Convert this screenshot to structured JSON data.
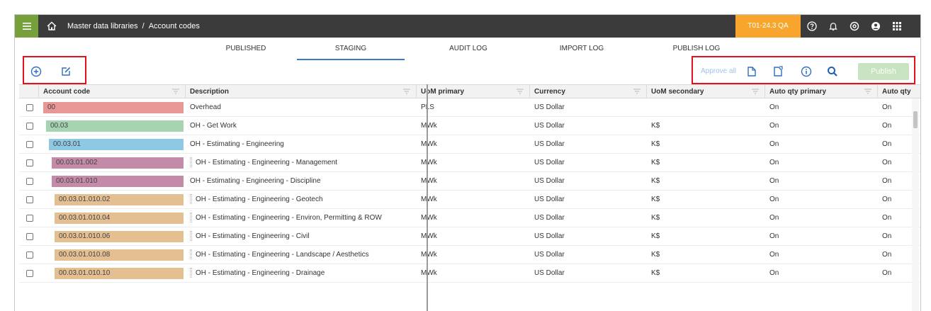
{
  "header": {
    "breadcrumb_root": "Master data libraries",
    "breadcrumb_separator": "/",
    "breadcrumb_current": "Account codes",
    "environment": "T01-24.3 QA",
    "icons": [
      "help-icon",
      "bell-icon",
      "settings-icon",
      "user-icon",
      "apps-grid-icon"
    ]
  },
  "tabs": [
    {
      "label": "PUBLISHED"
    },
    {
      "label": "STAGING",
      "active": true
    },
    {
      "label": "AUDIT LOG"
    },
    {
      "label": "IMPORT LOG"
    },
    {
      "label": "PUBLISH LOG"
    }
  ],
  "toolbar": {
    "approve_all": "Approve all",
    "publish": "Publish",
    "left_icons": [
      "add-circle-icon",
      "edit-icon"
    ],
    "right_icons": [
      "document-arrow-icon",
      "document-export-icon",
      "info-icon",
      "search-icon"
    ]
  },
  "grid": {
    "columns": [
      "Account code",
      "Description",
      "UoM primary",
      "Currency",
      "UoM secondary",
      "Auto qty primary",
      "Auto qty"
    ],
    "rows": [
      {
        "code": "00",
        "description": "Overhead",
        "uom_primary": "PLS",
        "currency": "US Dollar",
        "uom_secondary": "",
        "auto_qty_primary": "On",
        "auto_qty": "On",
        "color": "#e99696"
      },
      {
        "code": "00.03",
        "description": "OH - Get Work",
        "uom_primary": "MWk",
        "currency": "US Dollar",
        "uom_secondary": "K$",
        "auto_qty_primary": "On",
        "auto_qty": "On",
        "color": "#a6d4b3"
      },
      {
        "code": "00.03.01",
        "description": "OH - Estimating - Engineering",
        "uom_primary": "MWk",
        "currency": "US Dollar",
        "uom_secondary": "K$",
        "auto_qty_primary": "On",
        "auto_qty": "On",
        "color": "#8ec8e3"
      },
      {
        "code": "00.03.01.002",
        "description": "OH - Estimating - Engineering - Management",
        "uom_primary": "MWk",
        "currency": "US Dollar",
        "uom_secondary": "K$",
        "auto_qty_primary": "On",
        "auto_qty": "On",
        "color": "#c48ba8"
      },
      {
        "code": "00.03.01.010",
        "description": "OH - Estimating - Engineering - Discipline",
        "uom_primary": "MWk",
        "currency": "US Dollar",
        "uom_secondary": "K$",
        "auto_qty_primary": "On",
        "auto_qty": "On",
        "color": "#c48ba8"
      },
      {
        "code": "00.03.01.010.02",
        "description": "OH - Estimating - Engineering - Geotech",
        "uom_primary": "MWk",
        "currency": "US Dollar",
        "uom_secondary": "K$",
        "auto_qty_primary": "On",
        "auto_qty": "On",
        "color": "#e3bf92"
      },
      {
        "code": "00.03.01.010.04",
        "description": "OH - Estimating - Engineering - Environ, Permitting & ROW",
        "uom_primary": "MWk",
        "currency": "US Dollar",
        "uom_secondary": "K$",
        "auto_qty_primary": "On",
        "auto_qty": "On",
        "color": "#e3bf92"
      },
      {
        "code": "00.03.01.010.06",
        "description": "OH - Estimating - Engineering - Civil",
        "uom_primary": "MWk",
        "currency": "US Dollar",
        "uom_secondary": "K$",
        "auto_qty_primary": "On",
        "auto_qty": "On",
        "color": "#e3bf92"
      },
      {
        "code": "00.03.01.010.08",
        "description": "OH - Estimating - Engineering - Landscape / Aesthetics",
        "uom_primary": "MWk",
        "currency": "US Dollar",
        "uom_secondary": "K$",
        "auto_qty_primary": "On",
        "auto_qty": "On",
        "color": "#e3bf92"
      },
      {
        "code": "00.03.01.010.10",
        "description": "OH - Estimating - Engineering - Drainage",
        "uom_primary": "MWk",
        "currency": "US Dollar",
        "uom_secondary": "K$",
        "auto_qty_primary": "On",
        "auto_qty": "On",
        "color": "#e3bf92"
      }
    ]
  }
}
